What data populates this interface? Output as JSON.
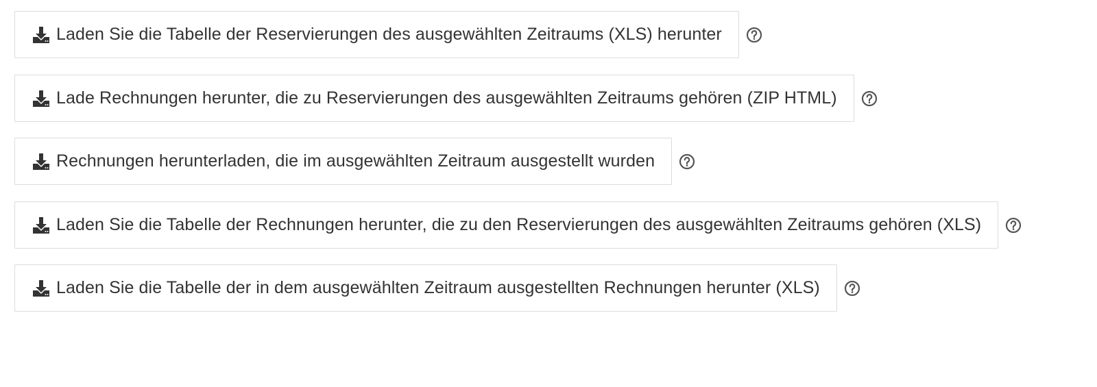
{
  "downloads": [
    {
      "label": "Laden Sie die Tabelle der Reservierungen des ausgewählten Zeitraums (XLS) herunter",
      "icon": "download-icon",
      "help_icon": "question-circle-icon"
    },
    {
      "label": "Lade Rechnungen herunter, die zu Reservierungen des ausgewählten Zeitraums gehören (ZIP HTML)",
      "icon": "download-icon",
      "help_icon": "question-circle-icon"
    },
    {
      "label": "Rechnungen herunterladen, die im ausgewählten Zeitraum ausgestellt wurden",
      "icon": "download-icon",
      "help_icon": "question-circle-icon"
    },
    {
      "label": "Laden Sie die Tabelle der Rechnungen herunter, die zu den Reservierungen des ausgewählten Zeitraums gehören (XLS)",
      "icon": "download-icon",
      "help_icon": "question-circle-icon"
    },
    {
      "label": "Laden Sie die Tabelle der in dem ausgewählten Zeitraum ausgestellten Rechnungen herunter (XLS)",
      "icon": "download-icon",
      "help_icon": "question-circle-icon"
    }
  ],
  "colors": {
    "text": "#333333",
    "border": "#dcdcdc",
    "icon": "#333333",
    "help_icon": "#555555"
  }
}
